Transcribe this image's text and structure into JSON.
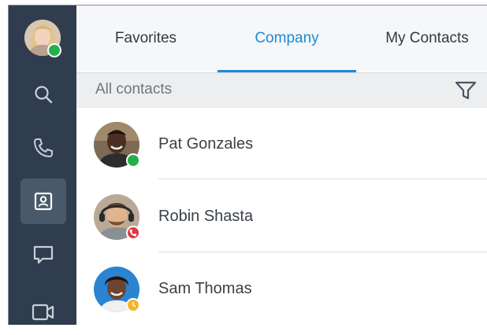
{
  "user": {
    "presence": "available",
    "presence_color": "#21b24b"
  },
  "rail": {
    "items": [
      {
        "icon": "search-icon"
      },
      {
        "icon": "phone-icon"
      },
      {
        "icon": "contacts-icon",
        "active": true
      },
      {
        "icon": "chat-icon"
      },
      {
        "icon": "video-icon"
      }
    ]
  },
  "tabs": [
    {
      "label": "Favorites"
    },
    {
      "label": "Company",
      "active": true
    },
    {
      "label": "My Contacts"
    }
  ],
  "filter": {
    "label": "All contacts",
    "icon": "filter-icon"
  },
  "contacts": [
    {
      "name": "Pat Gonzales",
      "presence": "available",
      "presence_color": "#21b24b"
    },
    {
      "name": "Robin Shasta",
      "presence": "on-call",
      "presence_color": "#e3383d"
    },
    {
      "name": "Sam Thomas",
      "presence": "away",
      "presence_color": "#f5b428"
    }
  ],
  "colors": {
    "accent": "#1b8ad6",
    "rail": "#2f3d4e"
  }
}
